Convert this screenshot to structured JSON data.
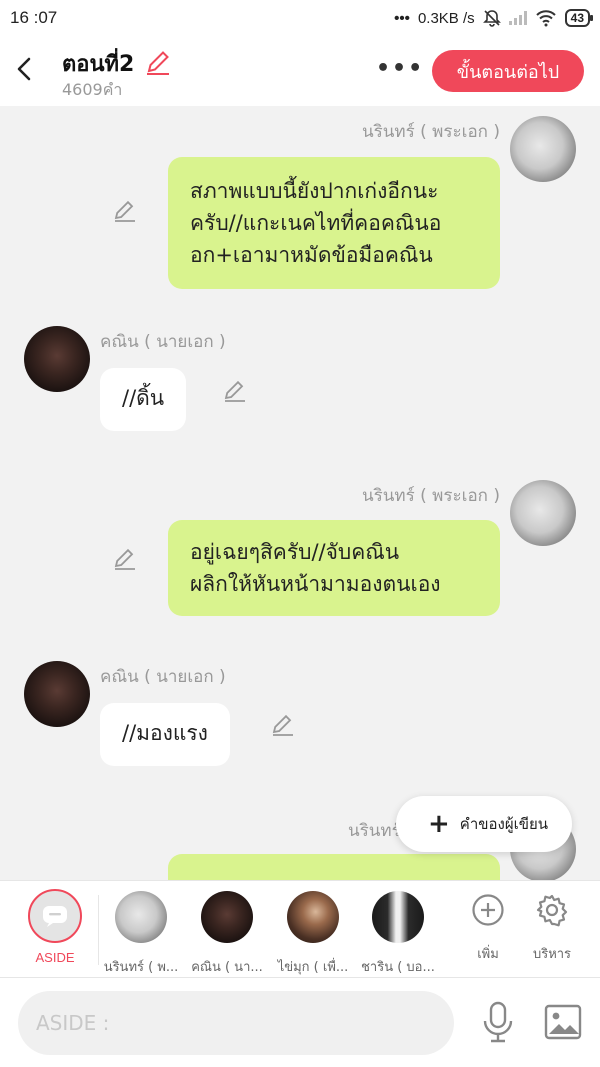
{
  "status_bar": {
    "time": "16 :07",
    "net_speed": "0.3KB /s",
    "battery": "43"
  },
  "header": {
    "title": "ตอนที่2",
    "word_count": "4609คำ",
    "next_button": "ขั้นตอนต่อไป"
  },
  "messages": [
    {
      "speaker": "นรินทร์ ( พระเอก )",
      "text": "สภาพแบบนี้ยังปากเก่งอีกนะครับ//แกะเนคไทที่คอคณินอ\nอก+เอามาหมัดข้อมือคณิน"
    },
    {
      "speaker": "คณิน ( นายเอก )",
      "text": "//ดิ้น"
    },
    {
      "speaker": "นรินทร์ ( พระเอก )",
      "text": "อยู่เฉยๆสิครับ//จับคณิน\nผลิกให้หันหน้ามามองตนเอง"
    },
    {
      "speaker": "คณิน ( นายเอก )",
      "text": "//มองแรง"
    },
    {
      "speaker": "นรินทร์",
      "text": ""
    }
  ],
  "fab": {
    "label": "คำของผู้เขียน"
  },
  "character_bar": {
    "aside_label": "ASIDE",
    "characters": [
      {
        "label": "นรินทร์ ( พ..."
      },
      {
        "label": "คณิน ( นา..."
      },
      {
        "label": "ไข่มุก ( เพื่..."
      },
      {
        "label": "ชาริน ( บอ..."
      }
    ],
    "add_label": "เพิ่ม",
    "manage_label": "บริหาร"
  },
  "input": {
    "placeholder": "ASIDE :",
    "value": ""
  },
  "colors": {
    "accent": "#f0485a",
    "bubble_green": "#d9f38e",
    "background": "#f2f2f2"
  }
}
